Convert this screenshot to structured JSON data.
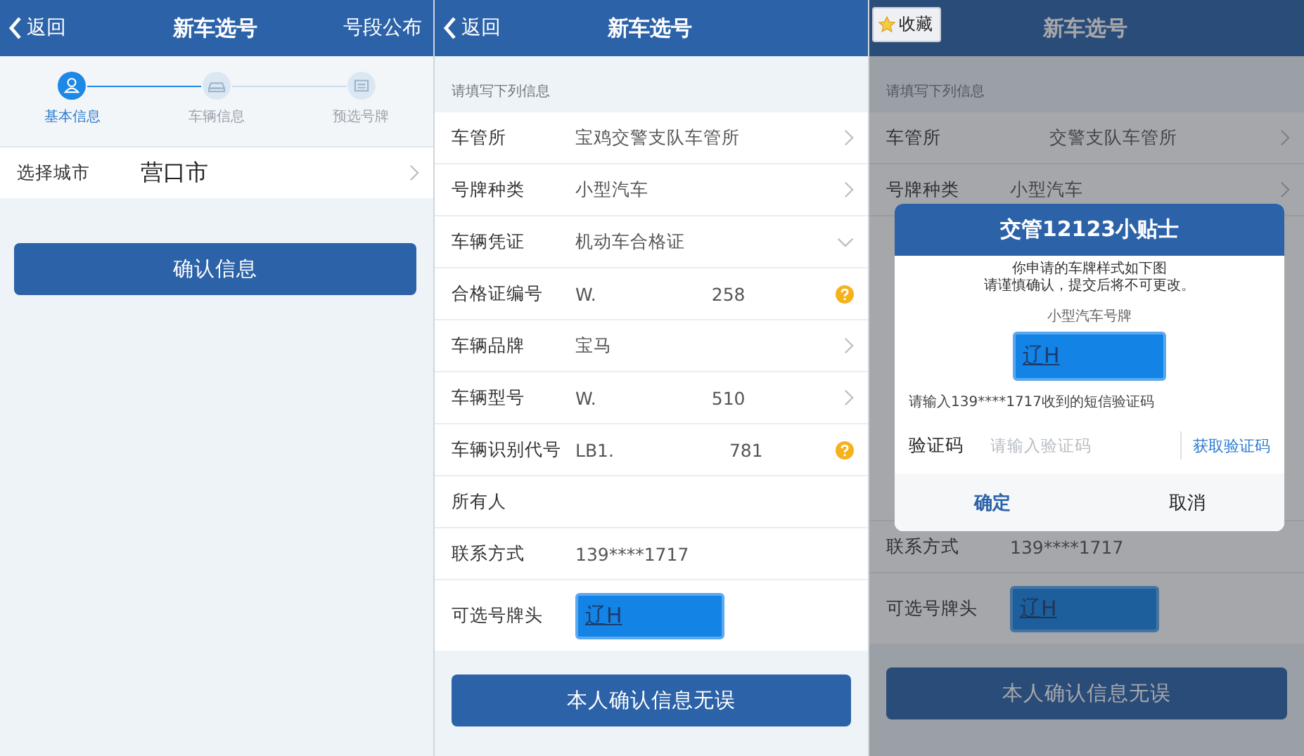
{
  "screens": [
    {
      "nav": {
        "back": "返回",
        "title": "新车选号",
        "action": "号段公布"
      },
      "steps": [
        {
          "label": "基本信息",
          "kind": "person",
          "selected": true
        },
        {
          "label": "车辆信息",
          "kind": "car",
          "selected": false
        },
        {
          "label": "预选号牌",
          "kind": "plate",
          "selected": false
        }
      ],
      "rows": [
        {
          "label": "选择城市",
          "value": "营口市",
          "kind": "select"
        }
      ],
      "button": "确认信息"
    },
    {
      "nav": {
        "back": "返回",
        "title": "新车选号"
      },
      "section": "请填写下列信息",
      "rows": [
        {
          "label": "车管所",
          "value": "宝鸡交警支队车管所",
          "kind": "select"
        },
        {
          "label": "号牌种类",
          "value": "小型汽车",
          "kind": "select"
        },
        {
          "label": "车辆凭证",
          "value": "机动车合格证",
          "kind": "dropdown"
        },
        {
          "label": "合格证编号",
          "value": "W.",
          "value_tail": "258",
          "kind": "help"
        },
        {
          "label": "车辆品牌",
          "value": "宝马",
          "kind": "select"
        },
        {
          "label": "车辆型号",
          "value": "W.",
          "value_tail": "510",
          "kind": "select"
        },
        {
          "label": "车辆识别代号",
          "value": "LB1.",
          "value_tail": "781",
          "kind": "help"
        },
        {
          "label": "所有人",
          "kind": "text"
        },
        {
          "label": "联系方式",
          "value": "139****1717",
          "kind": "text"
        },
        {
          "label": "可选号牌头",
          "value": "辽H",
          "kind": "plate"
        }
      ],
      "button": "本人确认信息无误"
    },
    {
      "favorite_button": "收藏",
      "nav": {
        "title": "新车选号"
      },
      "section": "请填写下列信息",
      "rows_above": [
        {
          "label": "车管所",
          "value": "交警支队车管所",
          "kind": "select"
        },
        {
          "label": "号牌种类",
          "value": "小型汽车",
          "kind": "select"
        }
      ],
      "rows_below": [
        {
          "label": "联系方式",
          "value": "139****1717",
          "kind": "text"
        },
        {
          "label": "可选号牌头",
          "value": "辽H",
          "kind": "plate"
        }
      ],
      "button": "本人确认信息无误",
      "dialog": {
        "title": "交管12123小贴士",
        "message": [
          "你申请的车牌样式如下图",
          "请谨慎确认，提交后将不可更改。"
        ],
        "plate_label": "小型汽车号牌",
        "plate": "辽H",
        "prompt": "请输入139****1717收到的短信验证码",
        "code_label": "验证码",
        "placeholder": "请输入验证码",
        "get_code": "获取验证码",
        "confirm": "确定",
        "cancel": "取消"
      }
    }
  ]
}
